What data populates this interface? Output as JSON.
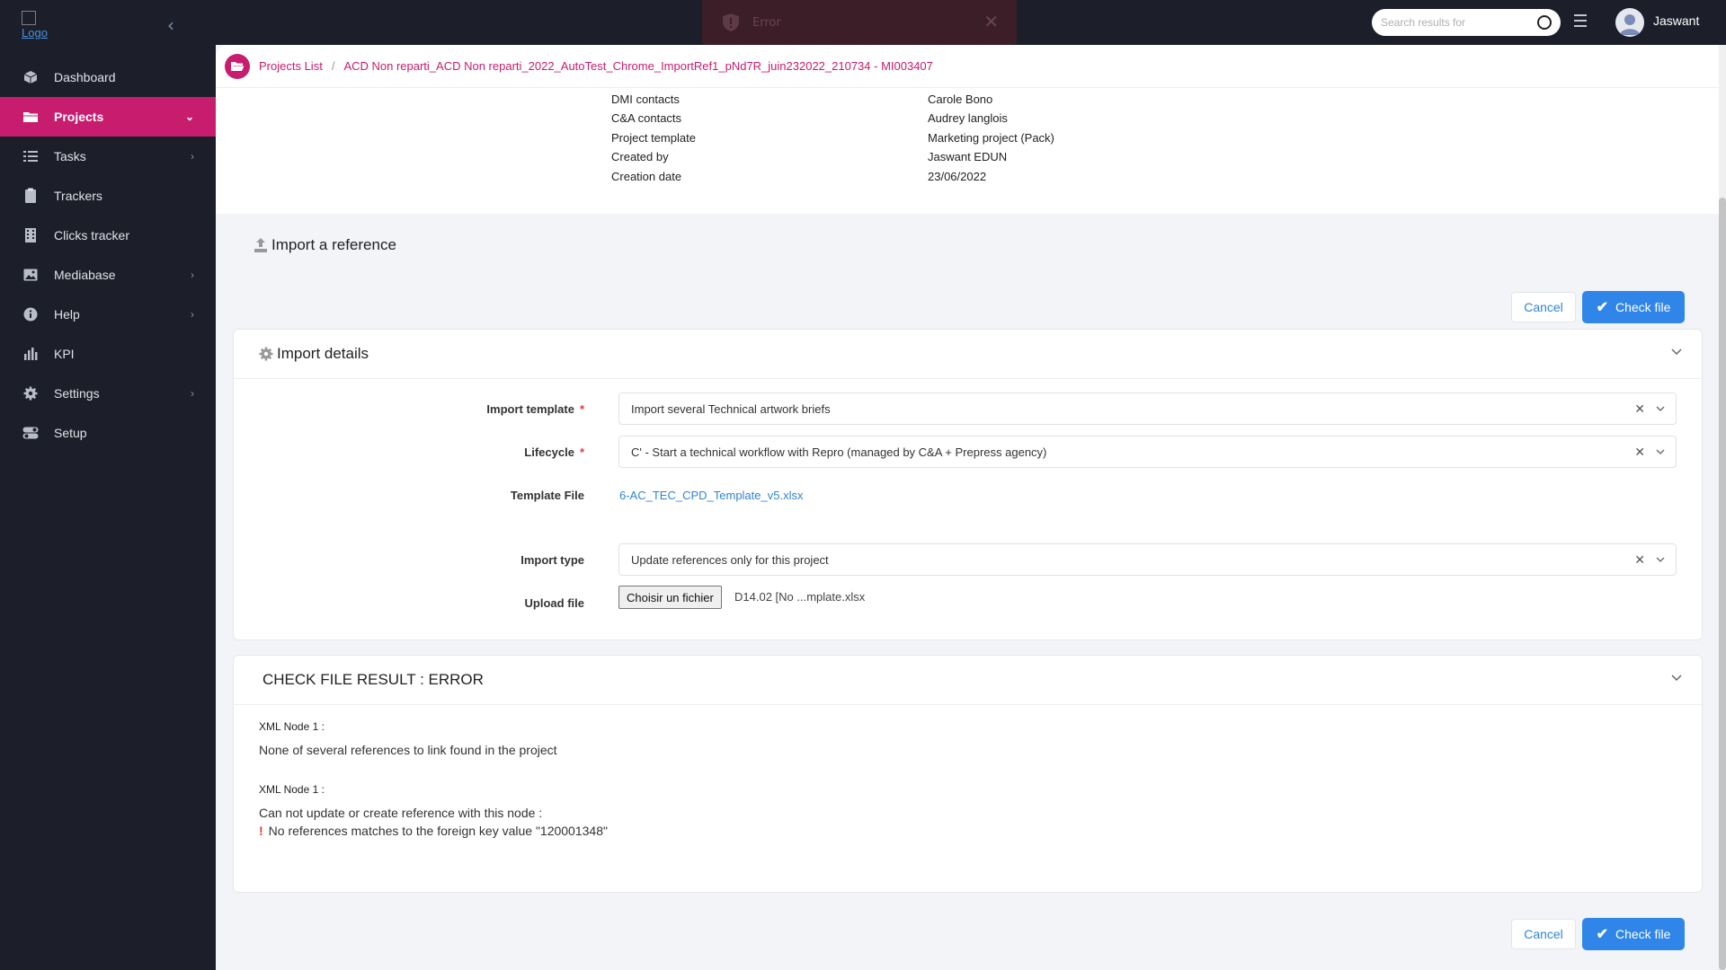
{
  "topbar": {
    "toast_text": "Error",
    "search_placeholder": "Search results for",
    "username": "Jaswant"
  },
  "sidebar": {
    "logo_alt": "Logo",
    "items": [
      {
        "label": "Dashboard",
        "icon": "cube-icon",
        "chevron": false
      },
      {
        "label": "Projects",
        "icon": "folder-icon",
        "chevron": true,
        "active": true
      },
      {
        "label": "Tasks",
        "icon": "list-icon",
        "chevron": true
      },
      {
        "label": "Trackers",
        "icon": "clipboard-icon",
        "chevron": false
      },
      {
        "label": "Clicks tracker",
        "icon": "building-icon",
        "chevron": false
      },
      {
        "label": "Mediabase",
        "icon": "image-icon",
        "chevron": true
      },
      {
        "label": "Help",
        "icon": "info-icon",
        "chevron": true
      },
      {
        "label": "KPI",
        "icon": "bar-chart-icon",
        "chevron": false
      },
      {
        "label": "Settings",
        "icon": "gear-icon",
        "chevron": true
      },
      {
        "label": "Setup",
        "icon": "toggle-icon",
        "chevron": false
      }
    ]
  },
  "breadcrumb": {
    "root": "Projects List",
    "separator": "/",
    "current": "ACD Non reparti_ACD Non reparti_2022_AutoTest_Chrome_ImportRef1_pNd7R_juin232022_210734 - MI003407"
  },
  "project_info": [
    {
      "key": "DMI contacts",
      "value": "Carole Bono"
    },
    {
      "key": "C&A contacts",
      "value": "Audrey langlois"
    },
    {
      "key": "Project template",
      "value": "Marketing project (Pack)"
    },
    {
      "key": "Created by",
      "value": "Jaswant EDUN"
    },
    {
      "key": "Creation date",
      "value": "23/06/2022"
    }
  ],
  "page": {
    "title": "Import a reference",
    "cancel_label": "Cancel",
    "check_label": "Check file"
  },
  "import_details": {
    "title": "Import details",
    "import_template_label": "Import template",
    "import_template_value": "Import several Technical artwork briefs",
    "lifecycle_label": "Lifecycle",
    "lifecycle_value": "C' - Start a technical workflow with Repro (managed by C&A + Prepress agency)",
    "template_file_label": "Template File",
    "template_file_link": "6-AC_TEC_CPD_Template_v5.xlsx",
    "import_type_label": "Import type",
    "import_type_value": "Update references only for this project",
    "upload_label": "Upload file",
    "upload_button": "Choisir un fichier",
    "upload_filename": "D14.02 [No ...mplate.xlsx",
    "required_mark": "*",
    "clear_mark": "✕"
  },
  "result": {
    "title": "CHECK FILE RESULT : ERROR",
    "node1_label": "XML Node 1 :",
    "node1_msg": "None of several references to link found in the project",
    "node2_label": "XML Node 1 :",
    "node2_msg": "Can not update or create reference with this node :",
    "node2_detail": "No references matches to the foreign key value \"120001348\"",
    "bang": "!"
  },
  "colors": {
    "accent": "#c81c6e",
    "primary_button": "#2f86e8",
    "sidebar_bg": "#1c1f2a",
    "error": "#e53935"
  }
}
